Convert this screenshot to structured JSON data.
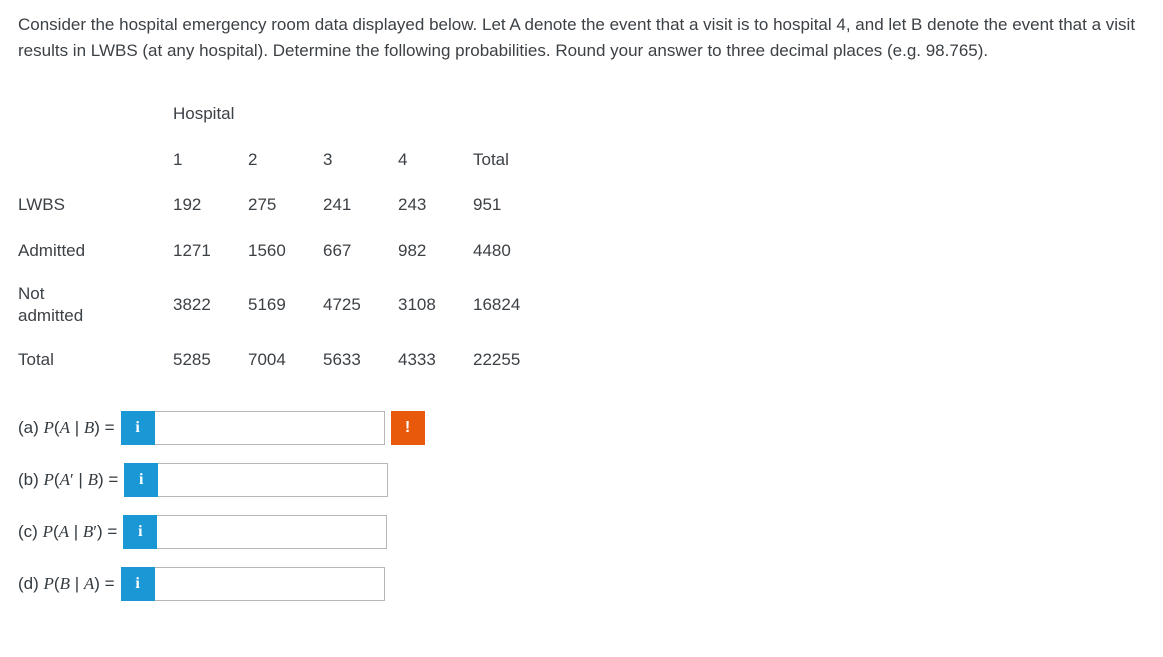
{
  "question": "Consider the hospital emergency room data displayed below. Let A denote the event that a visit is to hospital 4, and let B denote the event that a visit results in LWBS (at any hospital). Determine the following probabilities. Round your answer to three decimal places (e.g. 98.765).",
  "superheader": "Hospital",
  "cols": [
    "1",
    "2",
    "3",
    "4",
    "Total"
  ],
  "rows": [
    {
      "label": "LWBS",
      "vals": [
        "192",
        "275",
        "241",
        "243",
        "951"
      ]
    },
    {
      "label": "Admitted",
      "vals": [
        "1271",
        "1560",
        "667",
        "982",
        "4480"
      ]
    },
    {
      "label": "Not admitted",
      "vals": [
        "3822",
        "5169",
        "4725",
        "3108",
        "16824"
      ]
    },
    {
      "label": "Total",
      "vals": [
        "5285",
        "7004",
        "5633",
        "4333",
        "22255"
      ]
    }
  ],
  "parts": [
    {
      "letter": "(a)",
      "expr_html": "P(A | B) =",
      "value": "",
      "error": true,
      "pad": 0
    },
    {
      "letter": "(b)",
      "expr_html": "P(A′ | B) =",
      "value": "",
      "error": false,
      "pad": 10
    },
    {
      "letter": "(c)",
      "expr_html": "P(A | B′) =",
      "value": "",
      "error": false,
      "pad": 10
    },
    {
      "letter": "(d)",
      "expr_html": "P(B | A) =",
      "value": "",
      "error": false,
      "pad": 0
    }
  ],
  "glyphs": {
    "info": "i",
    "error": "!"
  }
}
